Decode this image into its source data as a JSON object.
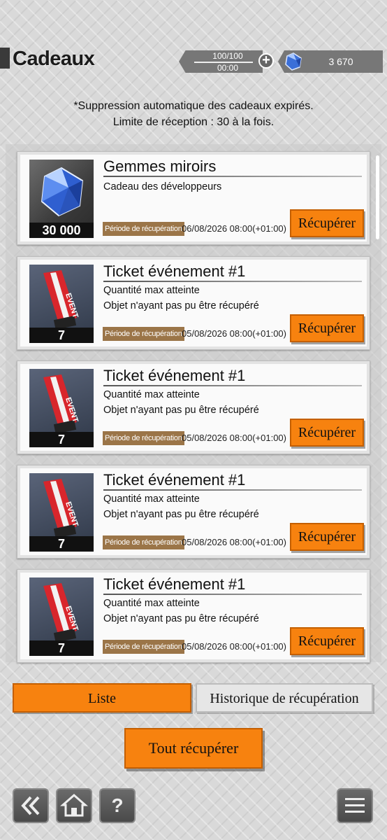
{
  "header": {
    "title": "Cadeaux",
    "stamina_value": "100/100",
    "stamina_timer": "00:00",
    "gem_count": "3 670"
  },
  "notice": {
    "line1": "*Suppression automatique des cadeaux expirés.",
    "line2": "Limite de réception : 30 à la fois."
  },
  "gifts": [
    {
      "name": "Gemmes miroirs",
      "desc1": "Cadeau des développeurs",
      "desc2": "",
      "qty": "30 000",
      "period_label": "Période de récupération",
      "date": "06/08/2026 08:00(+01:00)",
      "button": "Récupérer",
      "icon": "gem-icon"
    },
    {
      "name": "Ticket événement #1",
      "desc1": "Quantité max atteinte",
      "desc2": "Objet n'ayant pas pu être récupéré",
      "qty": "7",
      "period_label": "Période de récupération",
      "date": "05/08/2026 08:00(+01:00)",
      "button": "Récupérer",
      "icon": "event-ticket-icon"
    },
    {
      "name": "Ticket événement #1",
      "desc1": "Quantité max atteinte",
      "desc2": "Objet n'ayant pas pu être récupéré",
      "qty": "7",
      "period_label": "Période de récupération",
      "date": "05/08/2026 08:00(+01:00)",
      "button": "Récupérer",
      "icon": "event-ticket-icon"
    },
    {
      "name": "Ticket événement #1",
      "desc1": "Quantité max atteinte",
      "desc2": "Objet n'ayant pas pu être récupéré",
      "qty": "7",
      "period_label": "Période de récupération",
      "date": "05/08/2026 08:00(+01:00)",
      "button": "Récupérer",
      "icon": "event-ticket-icon"
    },
    {
      "name": "Ticket événement #1",
      "desc1": "Quantité max atteinte",
      "desc2": "Objet n'ayant pas pu être récupéré",
      "qty": "7",
      "period_label": "Période de récupération",
      "date": "05/08/2026 08:00(+01:00)",
      "button": "Récupérer",
      "icon": "event-ticket-icon"
    }
  ],
  "tabs": {
    "list": "Liste",
    "history": "Historique de récupération"
  },
  "claim_all": "Tout récupérer",
  "ticket_text": "EVENT",
  "nav": {
    "back_icon": "double-chevron-left-icon",
    "home_icon": "home-icon",
    "help_icon": "help-icon",
    "menu_icon": "menu-icon",
    "help_glyph": "?"
  },
  "colors": {
    "accent": "#f7820f",
    "period_label_bg": "#9b7548"
  }
}
